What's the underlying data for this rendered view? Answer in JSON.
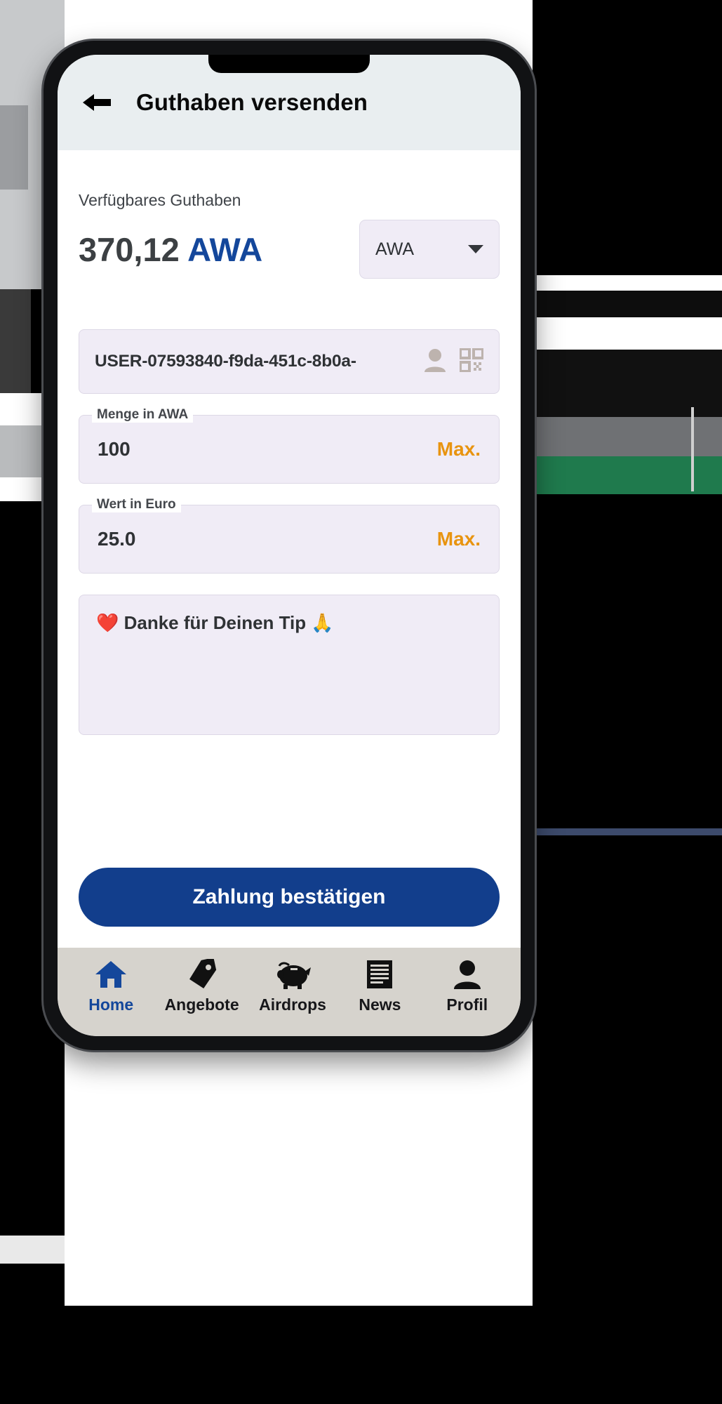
{
  "appbar": {
    "back_icon": "arrow-left-icon",
    "title": "Guthaben versenden"
  },
  "balance": {
    "label": "Verfügbares Guthaben",
    "amount": "370,12",
    "unit": "AWA",
    "currency_selector": {
      "value": "AWA",
      "icon": "chevron-down-icon",
      "options": [
        "AWA"
      ]
    }
  },
  "recipient": {
    "value": "USER-07593840-f9da-451c-8b0a-",
    "contact_icon": "person-icon",
    "qr_icon": "qr-code-icon"
  },
  "amount_field": {
    "legend": "Menge in AWA",
    "value": "100",
    "max_label": "Max."
  },
  "euro_field": {
    "legend": "Wert in Euro",
    "value": "25.0",
    "max_label": "Max."
  },
  "note_field": {
    "value": "❤️ Danke für Deinen Tip 🙏"
  },
  "confirm": {
    "label": "Zahlung bestätigen"
  },
  "bottomnav": {
    "items": [
      {
        "label": "Home",
        "icon": "home-icon",
        "active": true
      },
      {
        "label": "Angebote",
        "icon": "tag-icon",
        "active": false
      },
      {
        "label": "Airdrops",
        "icon": "piggy-bank-icon",
        "active": false
      },
      {
        "label": "News",
        "icon": "news-icon",
        "active": false
      },
      {
        "label": "Profil",
        "icon": "person-icon",
        "active": false
      }
    ]
  },
  "colors": {
    "accent_blue": "#14479b",
    "button_blue": "#123e8c",
    "max_orange": "#e89410",
    "field_bg": "#f0ecf6",
    "appbar_bg": "#e9eef0",
    "nav_bg": "#d6d3cd"
  }
}
